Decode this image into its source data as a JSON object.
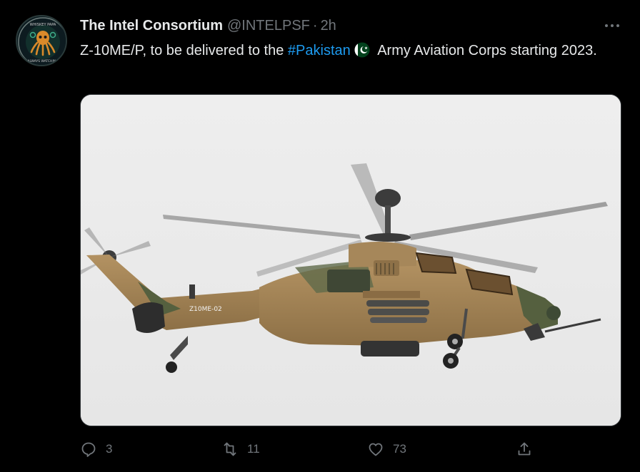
{
  "tweet": {
    "display_name": "The Intel Consortium",
    "handle": "@INTELPSF",
    "separator": "·",
    "time": "2h",
    "text_before": "Z-10ME/P, to be delivered to the ",
    "hashtag": "#Pakistan",
    "text_after": " Army Aviation Corps starting 2023.",
    "flag_emoji": "pakistan-flag-icon",
    "media": {
      "aircraft_marking": "Z10ME-02"
    },
    "stats": {
      "replies": "3",
      "retweets": "11",
      "likes": "73"
    }
  },
  "avatar": {
    "top_text": "WHISKEY PAPA",
    "bottom_text": "ALWAYS WATCHING"
  },
  "colors": {
    "background": "#000000",
    "text": "#e7e9ea",
    "secondary": "#71767b",
    "link": "#1d9bf0",
    "sky": "#ececec",
    "helicopter_body": "#a08253",
    "helicopter_dark": "#4e5a3a"
  },
  "icons": [
    "more-icon",
    "reply-icon",
    "retweet-icon",
    "like-icon",
    "share-icon"
  ]
}
